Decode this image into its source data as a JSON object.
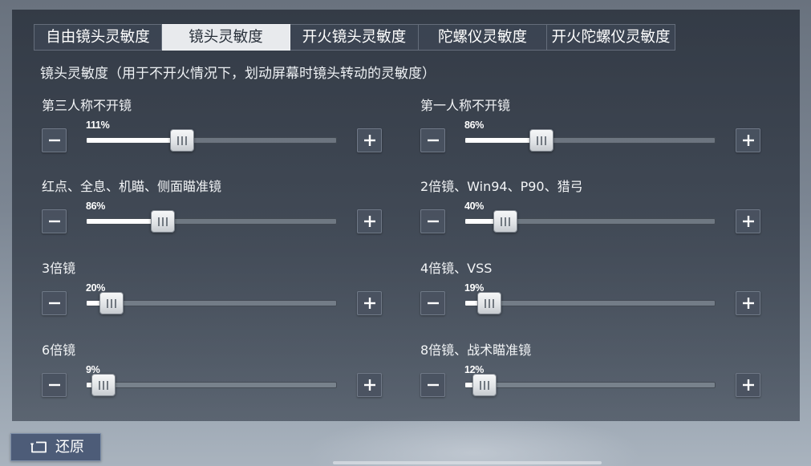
{
  "tabs": [
    {
      "label": "自由镜头灵敏度",
      "active": false
    },
    {
      "label": "镜头灵敏度",
      "active": true
    },
    {
      "label": "开火镜头灵敏度",
      "active": false
    },
    {
      "label": "陀螺仪灵敏度",
      "active": false
    },
    {
      "label": "开火陀螺仪灵敏度",
      "active": false
    }
  ],
  "description": "镜头灵敏度（用于不开火情况下，划动屏幕时镜头转动的灵敏度）",
  "sliders": [
    {
      "label": "第三人称不开镜",
      "value": 111,
      "value_text": "111%"
    },
    {
      "label": "第一人称不开镜",
      "value": 86,
      "value_text": "86%"
    },
    {
      "label": "红点、全息、机瞄、侧面瞄准镜",
      "value": 86,
      "value_text": "86%"
    },
    {
      "label": "2倍镜、Win94、P90、猎弓",
      "value": 40,
      "value_text": "40%"
    },
    {
      "label": "3倍镜",
      "value": 20,
      "value_text": "20%"
    },
    {
      "label": "4倍镜、VSS",
      "value": 19,
      "value_text": "19%"
    },
    {
      "label": "6倍镜",
      "value": 9,
      "value_text": "9%"
    },
    {
      "label": "8倍镜、战术瞄准镜",
      "value": 12,
      "value_text": "12%"
    }
  ],
  "reset_button": {
    "label": "还原",
    "icon": "reset-icon"
  },
  "icons": {
    "decrease": "minus-icon",
    "increase": "plus-icon",
    "thumb": "grip-icon",
    "reset": "reset-icon"
  },
  "colors": {
    "tab_active_bg": "#e8eaed",
    "tab_active_text": "#28303a",
    "text": "#ffffff",
    "track_fill": "#ffffff",
    "reset_button_bg": "#4d5c78"
  }
}
